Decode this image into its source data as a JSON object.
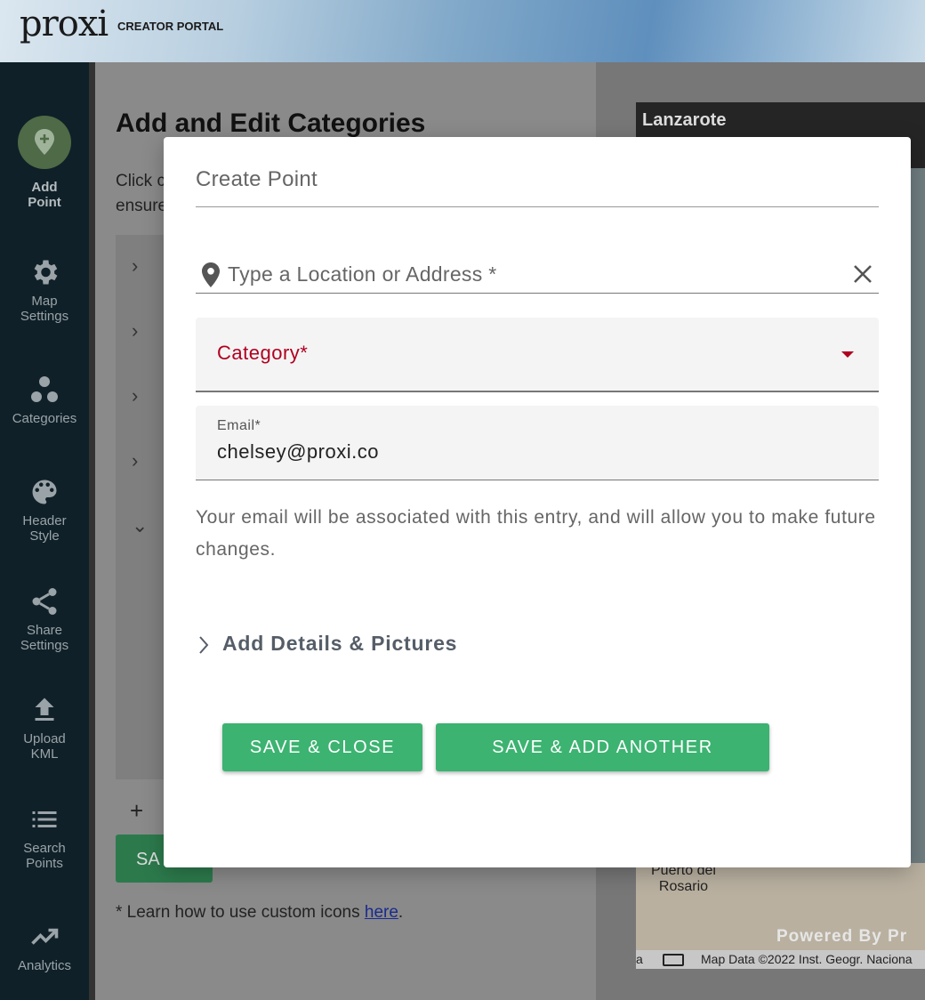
{
  "header": {
    "logo": "proxi",
    "subtitle": "CREATOR PORTAL"
  },
  "sidebar": {
    "items": [
      {
        "label_1": "Add",
        "label_2": "Point",
        "icon": "add-location-icon"
      },
      {
        "label_1": "Map",
        "label_2": "Settings",
        "icon": "gear-icon"
      },
      {
        "label_1": "Categories",
        "label_2": "",
        "icon": "categories-icon"
      },
      {
        "label_1": "Header",
        "label_2": "Style",
        "icon": "palette-icon"
      },
      {
        "label_1": "Share",
        "label_2": "Settings",
        "icon": "share-icon"
      },
      {
        "label_1": "Upload",
        "label_2": "KML",
        "icon": "upload-icon"
      },
      {
        "label_1": "Search",
        "label_2": "Points",
        "icon": "list-icon"
      },
      {
        "label_1": "Analytics",
        "label_2": "",
        "icon": "trending-up-icon"
      }
    ]
  },
  "main": {
    "title": "Add and Edit Categories",
    "text_line_1": "Click c",
    "text_line_2": "ensure",
    "add_symbol": "+",
    "save_label": "SA",
    "learn_text": "* Learn how to use custom icons ",
    "learn_link": "here",
    "learn_end": "."
  },
  "map": {
    "title": "Lanzarote",
    "town_line_1": "Puerto del",
    "town_line_2": "Rosario",
    "powered_by": "Powered By Pr",
    "footer": "Map Data ©2022 Inst. Geogr. Naciona",
    "footer_a": "a"
  },
  "modal": {
    "title": "Create Point",
    "location_placeholder": "Type a Location or Address *",
    "category_label": "Category*",
    "email_label": "Email*",
    "email_value": "chelsey@proxi.co",
    "helper_text": "Your email will be associated with this entry, and will allow you to make future changes.",
    "details_label": "Add Details & Pictures",
    "save_close_label": "SAVE & CLOSE",
    "save_another_label": "SAVE & ADD ANOTHER"
  },
  "colors": {
    "accent_green": "#3cb371",
    "error_red": "#b00020",
    "sidebar_bg": "#0f2028"
  }
}
